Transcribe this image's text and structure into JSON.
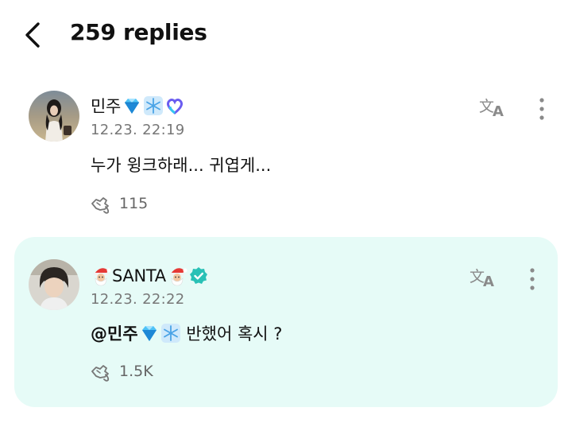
{
  "header": {
    "back_icon": "chevron-left-icon",
    "title": "259 replies"
  },
  "replies": [
    {
      "author": "민주",
      "author_badges": [
        "gem-emoji",
        "snowflake-emoji",
        "heart-badge-icon"
      ],
      "timestamp": "12.23. 22:19",
      "text": "누가 윙크하래... 귀엽게...",
      "likes": "115",
      "highlighted": false
    },
    {
      "author": "SANTA",
      "author_badges": [
        "santa-emoji",
        "santa-emoji",
        "verified-badge-icon"
      ],
      "timestamp": "12.23. 22:22",
      "mention": "@민주",
      "mention_badges": [
        "gem-emoji",
        "snowflake-emoji"
      ],
      "text": " 반했어 혹시 ?",
      "likes": "1.5K",
      "highlighted": true
    }
  ],
  "icons": {
    "translate": "translate-icon",
    "more": "more-vertical-icon",
    "like": "like-hand-icon"
  },
  "colors": {
    "highlight_bg": "#e6fbf7",
    "verified": "#29c1b6",
    "gem": "#2aa9e0",
    "muted": "#777777"
  }
}
